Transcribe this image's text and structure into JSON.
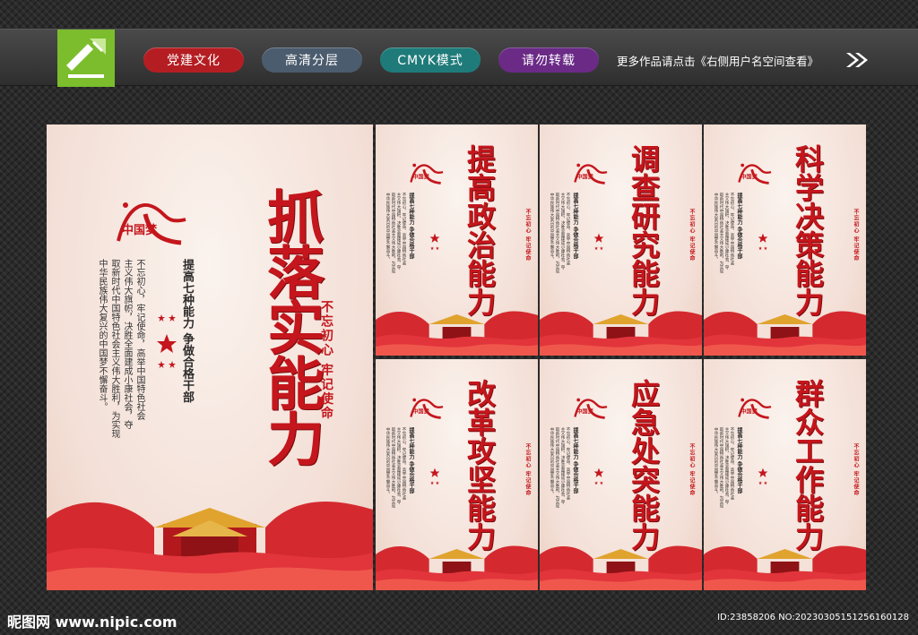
{
  "header": {
    "tags": [
      "党建文化",
      "高清分层",
      "CMYK模式",
      "请勿转载"
    ],
    "notice": "更多作品请点击《右侧用户名空间查看》"
  },
  "poster_main": {
    "title": "抓落实能力",
    "slogan": "不忘初心 牢记使命",
    "subtitle": "提高七种能力 争做合格干部",
    "body": "不忘初心，牢记使命，高举中国特色社会\n主义伟大旗帜，决胜全面建成小康社会，夺\n取新时代中国特色社会主义伟大胜利，为实现\n中华民族伟大复兴的中国梦不懈奋斗。",
    "emblem_text": "中国梦"
  },
  "posters_small": [
    {
      "title": "提高政治能力"
    },
    {
      "title": "调查研究能力"
    },
    {
      "title": "科学决策能力"
    },
    {
      "title": "改革攻坚能力"
    },
    {
      "title": "应急处突能力"
    },
    {
      "title": "群众工作能力"
    }
  ],
  "footer": {
    "watermark": "昵图网 www.nipic.com",
    "id_text": "ID:23858206 NO:20230305151256160128"
  },
  "colors": {
    "accent_red": "#c4161c",
    "poster_bg": "#f6e6de",
    "logo_green": "#7bbd2c"
  }
}
